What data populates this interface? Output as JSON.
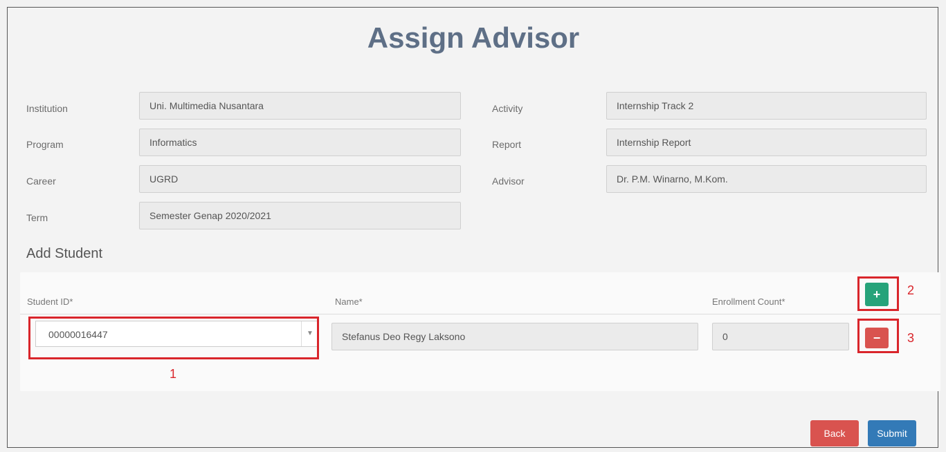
{
  "page": {
    "title": "Assign Advisor"
  },
  "info": {
    "institution": {
      "label": "Institution",
      "value": "Uni. Multimedia Nusantara"
    },
    "program": {
      "label": "Program",
      "value": "Informatics"
    },
    "career": {
      "label": "Career",
      "value": "UGRD"
    },
    "term": {
      "label": "Term",
      "value": "Semester Genap 2020/2021"
    },
    "activity": {
      "label": "Activity",
      "value": "Internship Track 2"
    },
    "report": {
      "label": "Report",
      "value": "Internship Report"
    },
    "advisor": {
      "label": "Advisor",
      "value": "Dr. P.M. Winarno, M.Kom."
    }
  },
  "add_student": {
    "title": "Add Student",
    "columns": {
      "student_id": "Student ID*",
      "name": "Name*",
      "enrollment": "Enrollment Count*"
    },
    "row": {
      "student_id": "00000016447",
      "name": "Stefanus Deo Regy Laksono",
      "enrollment": "0"
    },
    "add_label": "+",
    "remove_label": "−"
  },
  "annotations": {
    "one": "1",
    "two": "2",
    "three": "3"
  },
  "actions": {
    "back": "Back",
    "submit": "Submit"
  },
  "colors": {
    "title": "#5e6f86",
    "add": "#26a37a",
    "remove": "#d9534f",
    "submit": "#337ab7",
    "highlight": "#d9252b"
  }
}
